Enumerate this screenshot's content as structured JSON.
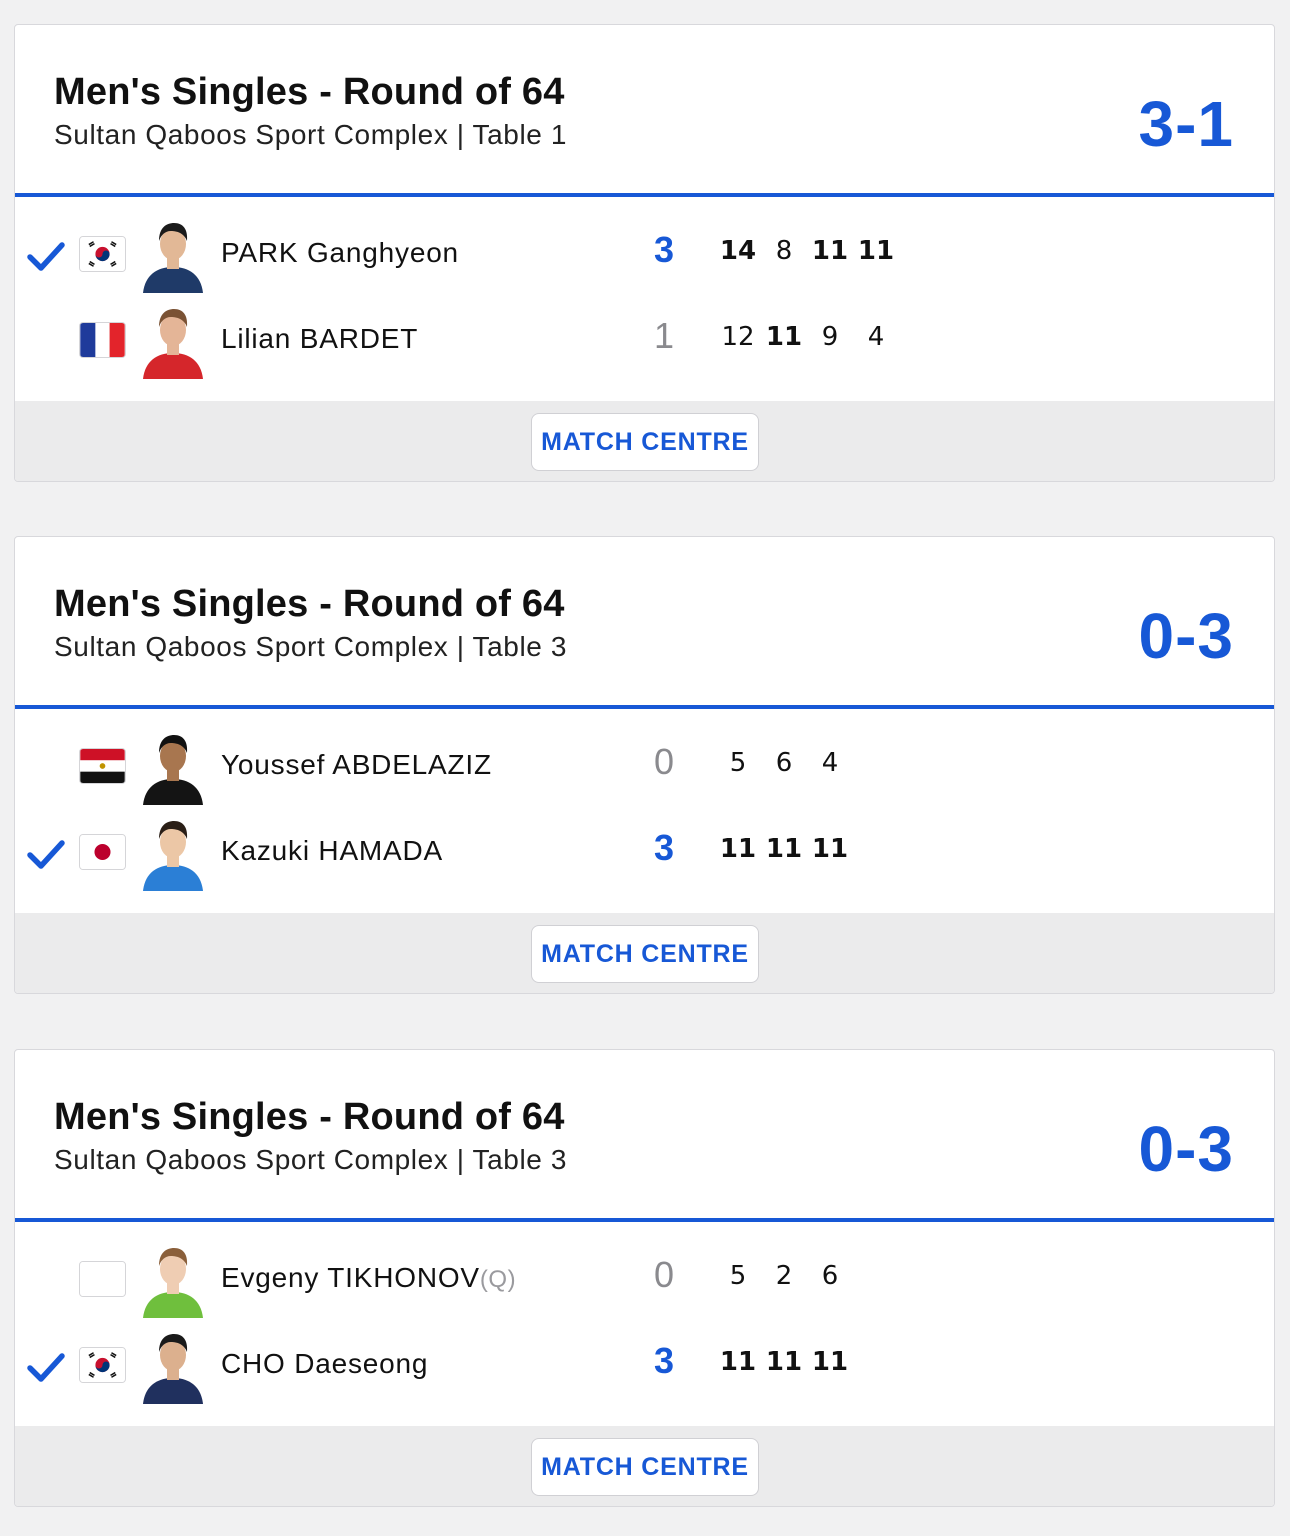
{
  "matches": [
    {
      "title": "Men's Singles - Round of 64",
      "venue": "Sultan Qaboos Sport Complex | Table 1",
      "score": "3-1",
      "button_label": "MATCH CENTRE",
      "players": [
        {
          "name": "PARK Ganghyeon",
          "tag": "",
          "winner": true,
          "flag": "south-korea-flag",
          "games": "3",
          "sets": [
            {
              "v": "14",
              "won": true
            },
            {
              "v": "8",
              "won": false
            },
            {
              "v": "11",
              "won": true
            },
            {
              "v": "11",
              "won": true
            }
          ],
          "avatar_skin": "#e2b896",
          "avatar_hair": "#1b1b1b",
          "avatar_shirt": "#1f3a68"
        },
        {
          "name": "Lilian BARDET",
          "tag": "",
          "winner": false,
          "flag": "france-flag",
          "games": "1",
          "sets": [
            {
              "v": "12",
              "won": false
            },
            {
              "v": "11",
              "won": true
            },
            {
              "v": "9",
              "won": false
            },
            {
              "v": "4",
              "won": false
            }
          ],
          "avatar_skin": "#e4b597",
          "avatar_hair": "#7a5234",
          "avatar_shirt": "#d5262b"
        }
      ]
    },
    {
      "title": "Men's Singles - Round of 64",
      "venue": "Sultan Qaboos Sport Complex | Table 3",
      "score": "0-3",
      "button_label": "MATCH CENTRE",
      "players": [
        {
          "name": "Youssef ABDELAZIZ",
          "tag": "",
          "winner": false,
          "flag": "egypt-flag",
          "games": "0",
          "sets": [
            {
              "v": "5",
              "won": false
            },
            {
              "v": "6",
              "won": false
            },
            {
              "v": "4",
              "won": false
            }
          ],
          "avatar_skin": "#a8764f",
          "avatar_hair": "#111111",
          "avatar_shirt": "#141414"
        },
        {
          "name": "Kazuki HAMADA",
          "tag": "",
          "winner": true,
          "flag": "japan-flag",
          "games": "3",
          "sets": [
            {
              "v": "11",
              "won": true
            },
            {
              "v": "11",
              "won": true
            },
            {
              "v": "11",
              "won": true
            }
          ],
          "avatar_skin": "#ecc7a6",
          "avatar_hair": "#2a1e16",
          "avatar_shirt": "#2b7fd6"
        }
      ]
    },
    {
      "title": "Men's Singles - Round of 64",
      "venue": "Sultan Qaboos Sport Complex | Table 3",
      "score": "0-3",
      "button_label": "MATCH CENTRE",
      "players": [
        {
          "name": "Evgeny TIKHONOV",
          "tag": "(Q)",
          "winner": false,
          "flag": "blank-flag",
          "games": "0",
          "sets": [
            {
              "v": "5",
              "won": false
            },
            {
              "v": "2",
              "won": false
            },
            {
              "v": "6",
              "won": false
            }
          ],
          "avatar_skin": "#efcdb3",
          "avatar_hair": "#8a5f3a",
          "avatar_shirt": "#6fbf3d"
        },
        {
          "name": "CHO Daeseong",
          "tag": "",
          "winner": true,
          "flag": "south-korea-flag",
          "games": "3",
          "sets": [
            {
              "v": "11",
              "won": true
            },
            {
              "v": "11",
              "won": true
            },
            {
              "v": "11",
              "won": true
            }
          ],
          "avatar_skin": "#dcb08e",
          "avatar_hair": "#1a1a1a",
          "avatar_shirt": "#20305e"
        }
      ]
    }
  ],
  "colors": {
    "accent": "#1758d6",
    "loser_score": "#8a8a8e",
    "page_bg": "#f1f1f2",
    "footer_bg": "#ebebec"
  },
  "icons": {
    "winner": "checkmark-icon"
  }
}
